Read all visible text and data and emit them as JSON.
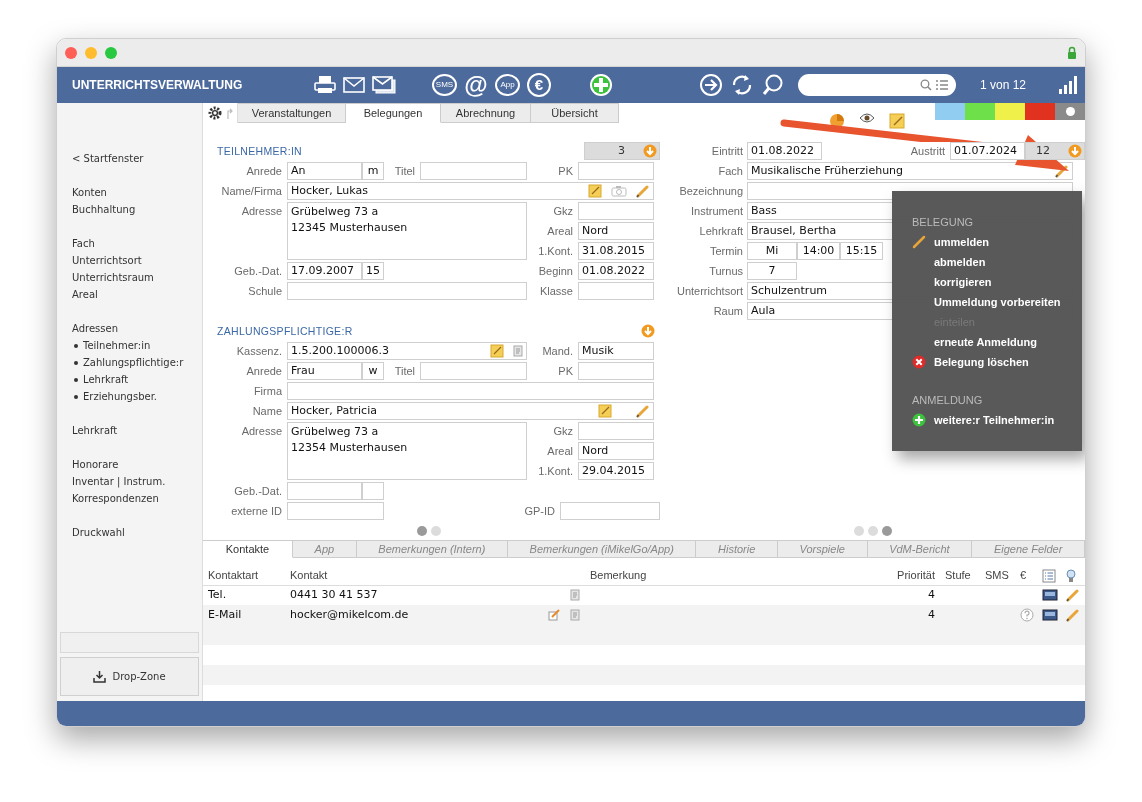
{
  "app_title": "UNTERRICHTSVERWALTUNG",
  "toolbar_groups": [
    [
      {
        "kind": "print"
      },
      {
        "kind": "mail"
      },
      {
        "kind": "mail-stack"
      }
    ],
    [
      {
        "kind": "sms",
        "label": "SMS"
      },
      {
        "kind": "at",
        "label": "@"
      },
      {
        "kind": "app",
        "label": "App"
      },
      {
        "kind": "euro",
        "label": "€"
      }
    ],
    [
      {
        "kind": "add"
      }
    ],
    [
      {
        "kind": "forward"
      },
      {
        "kind": "refresh"
      },
      {
        "kind": "search"
      }
    ]
  ],
  "record_counter": "1 von 12",
  "tabs": [
    {
      "label": "Veranstaltungen",
      "selected": false
    },
    {
      "label": "Belegungen",
      "selected": true
    },
    {
      "label": "Abrechnung",
      "selected": false
    },
    {
      "label": "Übersicht",
      "selected": false
    }
  ],
  "color_tags": [
    {
      "color": "#90cdf0",
      "selected": false
    },
    {
      "color": "#6ee04a",
      "selected": false
    },
    {
      "color": "#f0f04a",
      "selected": false
    },
    {
      "color": "#e0321e",
      "selected": false
    },
    {
      "color": "#8a8a8a",
      "selected": true
    }
  ],
  "sidebar": {
    "groups": [
      {
        "items": [
          {
            "label": "< Startfenster"
          }
        ]
      },
      {
        "items": [
          {
            "label": "Konten"
          },
          {
            "label": "Buchhaltung"
          }
        ]
      },
      {
        "items": [
          {
            "label": "Fach"
          },
          {
            "label": "Unterrichtsort"
          },
          {
            "label": "Unterrichtsraum"
          },
          {
            "label": "Areal"
          }
        ]
      },
      {
        "items": [
          {
            "label": "Adressen",
            "children": [
              {
                "label": "Teilnehmer:in"
              },
              {
                "label": "Zahlungspflichtige:r"
              },
              {
                "label": "Lehrkraft"
              },
              {
                "label": "Erziehungsber."
              }
            ]
          }
        ]
      },
      {
        "items": [
          {
            "label": "Lehrkraft"
          }
        ]
      },
      {
        "items": [
          {
            "label": "Honorare"
          },
          {
            "label": "Inventar | Instrum."
          },
          {
            "label": "Korrespondenzen"
          }
        ]
      },
      {
        "items": [
          {
            "label": "Druckwahl"
          }
        ]
      }
    ],
    "drop_zone": "Drop-Zone"
  },
  "participant": {
    "heading": "TEILNEHMER:IN",
    "count": "3",
    "anrede": {
      "label": "Anrede",
      "value": "An",
      "gender": "m"
    },
    "titel": {
      "label": "Titel"
    },
    "pk": {
      "label": "PK"
    },
    "name": {
      "label": "Name/Firma",
      "value": "Hocker, Lukas"
    },
    "adresse": {
      "label": "Adresse",
      "lines": [
        "Grübelweg 73 a",
        "12345 Musterhausen"
      ]
    },
    "gkz": {
      "label": "Gkz"
    },
    "areal": {
      "label": "Areal",
      "value": "Nord"
    },
    "first_contact": {
      "label": "1.Kont.",
      "value": "31.08.2015"
    },
    "birth": {
      "label": "Geb.-Dat.",
      "value": "17.09.2007",
      "age": "15"
    },
    "beginn": {
      "label": "Beginn",
      "value": "01.08.2022"
    },
    "schule": {
      "label": "Schule"
    },
    "klasse": {
      "label": "Klasse"
    }
  },
  "payer": {
    "heading": "ZAHLUNGSPFLICHTIGE:R",
    "kassenz": {
      "label": "Kassenz.",
      "value": "1.5.200.100006.3"
    },
    "mand": {
      "label": "Mand.",
      "value": "Musik"
    },
    "anrede": {
      "label": "Anrede",
      "value": "Frau",
      "gender": "w"
    },
    "titel": {
      "label": "Titel"
    },
    "pk": {
      "label": "PK"
    },
    "firma": {
      "label": "Firma"
    },
    "name": {
      "label": "Name",
      "value": "Hocker, Patricia"
    },
    "adresse": {
      "label": "Adresse",
      "lines": [
        "Grübelweg 73 a",
        "12354 Musterhausen"
      ]
    },
    "gkz": {
      "label": "Gkz"
    },
    "areal": {
      "label": "Areal",
      "value": "Nord"
    },
    "first_contact": {
      "label": "1.Kont.",
      "value": "29.04.2015"
    },
    "birth": {
      "label": "Geb.-Dat."
    },
    "external_id": {
      "label": "externe ID"
    },
    "gp_id": {
      "label": "GP-ID"
    }
  },
  "left_pages": [
    {
      "selected": true
    },
    {
      "selected": false
    }
  ],
  "booking": {
    "eintritt": {
      "label": "Eintritt",
      "value": "01.08.2022"
    },
    "austritt": {
      "label": "Austritt",
      "value": "01.07.2024"
    },
    "count": "12",
    "fach": {
      "label": "Fach",
      "value": "Musikalische Früherziehung"
    },
    "bezeichnung": {
      "label": "Bezeichnung"
    },
    "instrument": {
      "label": "Instrument",
      "value": "Bass"
    },
    "lehrkraft": {
      "label": "Lehrkraft",
      "value": "Brausel, Bertha"
    },
    "termin": {
      "label": "Termin",
      "day": "Mi",
      "from": "14:00",
      "to": "15:15"
    },
    "turnus": {
      "label": "Turnus",
      "value": "7"
    },
    "unterrichtsort": {
      "label": "Unterrichtsort",
      "value": "Schulzentrum"
    },
    "raum": {
      "label": "Raum",
      "value": "Aula"
    }
  },
  "right_pages": [
    {
      "selected": false
    },
    {
      "selected": false
    },
    {
      "selected": true
    }
  ],
  "context_menu": {
    "sections": [
      {
        "heading": "BELEGUNG",
        "items": [
          {
            "label": "ummelden",
            "kind": "pencil",
            "disabled": false
          },
          {
            "label": "abmelden",
            "kind": "plain",
            "disabled": false
          },
          {
            "label": "korrigieren",
            "kind": "plain",
            "disabled": false
          },
          {
            "label": "Ummeldung vorbereiten",
            "kind": "plain",
            "disabled": false
          },
          {
            "label": "einteilen",
            "kind": "plain",
            "disabled": true
          },
          {
            "label": "erneute Anmeldung",
            "kind": "plain",
            "disabled": false
          },
          {
            "label": "Belegung löschen",
            "kind": "delete",
            "disabled": false
          }
        ]
      },
      {
        "heading": "ANMELDUNG",
        "items": [
          {
            "label": "weitere:r Teilnehmer:in",
            "kind": "add",
            "disabled": false
          }
        ]
      }
    ]
  },
  "bottom_tabs": [
    {
      "label": "Kontakte",
      "selected": true
    },
    {
      "label": "App",
      "selected": false
    },
    {
      "label": "Bemerkungen (Intern)",
      "selected": false
    },
    {
      "label": "Bemerkungen (iMikelGo/App)",
      "selected": false
    },
    {
      "label": "Historie",
      "selected": false
    },
    {
      "label": "Vorspiele",
      "selected": false
    },
    {
      "label": "VdM-Bericht",
      "selected": false
    },
    {
      "label": "Eigene Felder",
      "selected": false
    }
  ],
  "contacts": {
    "columns": [
      "Kontaktart",
      "Kontakt",
      "Bemerkung",
      "Priorität",
      "Stufe",
      "SMS",
      "€"
    ],
    "rows": [
      {
        "type": "Tel.",
        "contact": "0441 30 41 537",
        "priority": "4",
        "compose": false,
        "help": false
      },
      {
        "type": "E-Mail",
        "contact": "hocker@mikelcom.de",
        "priority": "4",
        "compose": true,
        "help": true
      }
    ]
  }
}
